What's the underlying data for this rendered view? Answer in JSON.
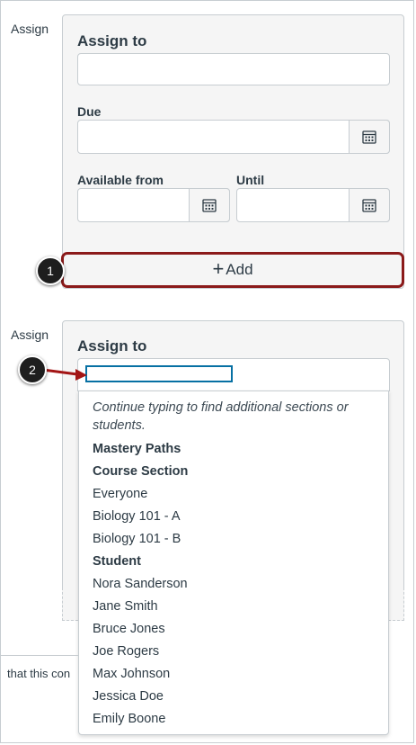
{
  "card1": {
    "assign_label": "Assign",
    "assign_to_label": "Assign to",
    "due_label": "Due",
    "available_from_label": "Available from",
    "until_label": "Until",
    "add_button": "Add"
  },
  "card2": {
    "assign_label": "Assign",
    "assign_to_label": "Assign to",
    "search_value": ""
  },
  "callouts": {
    "step1": "1",
    "step2": "2"
  },
  "dropdown": {
    "hint": "Continue typing to find additional sections or students.",
    "items": [
      {
        "label": "Mastery Paths",
        "type": "group"
      },
      {
        "label": "Course Section",
        "type": "group"
      },
      {
        "label": "Everyone",
        "type": "option"
      },
      {
        "label": "Biology 101 - A",
        "type": "option"
      },
      {
        "label": "Biology 101 - B",
        "type": "option"
      },
      {
        "label": "Student",
        "type": "group"
      },
      {
        "label": "Nora Sanderson",
        "type": "option"
      },
      {
        "label": "Jane Smith",
        "type": "option"
      },
      {
        "label": "Bruce Jones",
        "type": "option"
      },
      {
        "label": "Joe Rogers",
        "type": "option"
      },
      {
        "label": "Max Johnson",
        "type": "option"
      },
      {
        "label": "Jessica Doe",
        "type": "option"
      },
      {
        "label": "Emily Boone",
        "type": "option"
      }
    ]
  },
  "footer_text": "that this con",
  "colors": {
    "highlight_border": "#8b1a1a",
    "focus_border": "#0770a3",
    "arrow": "#a31515"
  }
}
